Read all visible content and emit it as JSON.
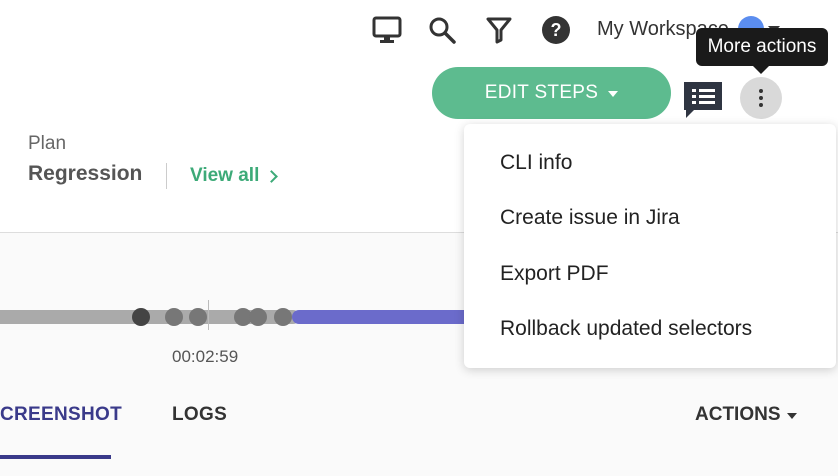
{
  "topbar": {
    "workspace_label": "My Workspace",
    "icons": [
      "monitor-icon",
      "search-icon",
      "filter-icon",
      "help-icon",
      "avatar",
      "chevron-down-icon"
    ]
  },
  "tooltip": {
    "text": "More actions"
  },
  "toolbar": {
    "edit_steps_label": "EDIT STEPS"
  },
  "plan": {
    "label": "Plan",
    "value": "Regression",
    "view_all_label": "View all"
  },
  "timeline": {
    "timestamp": "00:02:59"
  },
  "tabs": [
    {
      "label": "CREENSHOT",
      "active": true
    },
    {
      "label": "LOGS",
      "active": false
    }
  ],
  "actions_label": "ACTIONS",
  "menu": {
    "items": [
      {
        "label": "CLI info"
      },
      {
        "label": "Create issue in Jira"
      },
      {
        "label": "Export PDF"
      },
      {
        "label": "Rollback updated selectors"
      }
    ]
  },
  "colors": {
    "accent_green": "#5dbb8f",
    "link_green": "#3daa78",
    "progress_blue": "#6b6bcb",
    "tab_active": "#3a3a8a",
    "tooltip_bg": "#1a1a1a"
  }
}
